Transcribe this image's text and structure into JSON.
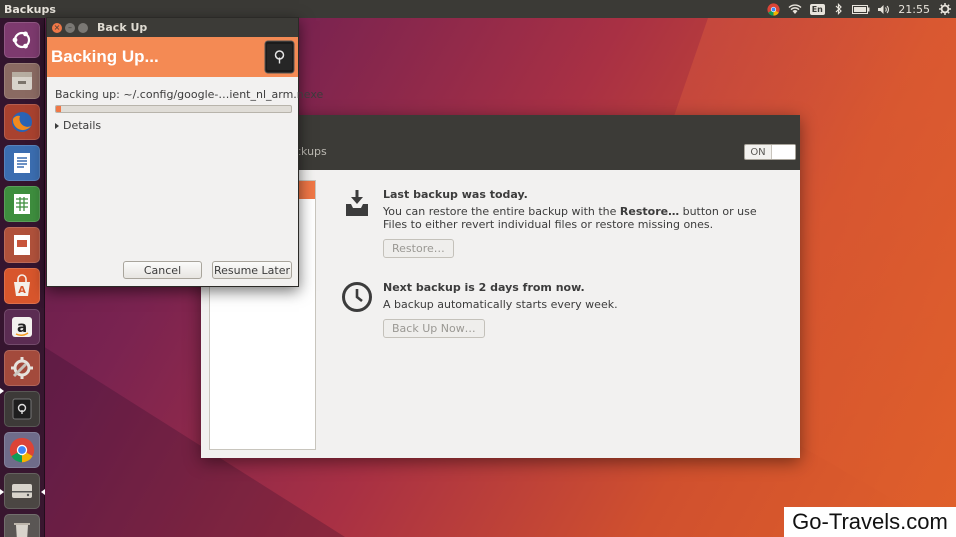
{
  "top_panel": {
    "app_title": "Backups",
    "keyboard_layout": "En",
    "clock": "21:55",
    "icons": [
      "chrome-icon",
      "wifi-icon",
      "keyboard-icon",
      "bluetooth-icon",
      "battery-icon",
      "volume-icon",
      "gear-icon"
    ]
  },
  "launcher": {
    "items": [
      "ubuntu-dash-icon",
      "files-icon",
      "firefox-icon",
      "libreoffice-writer-icon",
      "libreoffice-calc-icon",
      "libreoffice-impress-icon",
      "software-center-icon",
      "amazon-icon",
      "system-settings-icon",
      "backups-icon",
      "chrome-icon",
      "drive-icon",
      "trash-icon"
    ]
  },
  "dialog": {
    "title": "Back Up",
    "heading": "Backing Up...",
    "status": "Backing up: ~/.config/google-…ient_nl_arm.nexe",
    "progress": 0.02,
    "details_label": "Details",
    "cancel_label": "Cancel",
    "resume_label": "Resume Later"
  },
  "main_window": {
    "header_label": "ckups",
    "switch_label": "ON",
    "last_backup": {
      "title": "Last backup was today.",
      "desc_pre": "You can restore the entire backup with the ",
      "desc_bold": "Restore…",
      "desc_post": " button or use Files to either revert individual files or restore missing ones.",
      "button": "Restore…"
    },
    "next_backup": {
      "title": "Next backup is 2 days from now.",
      "desc": "A backup automatically starts every week.",
      "button": "Back Up Now…"
    }
  },
  "watermark": "Go-Travels.com",
  "colors": {
    "accent": "#f07746",
    "banner": "#f48a54",
    "panel": "#3b3a36"
  }
}
